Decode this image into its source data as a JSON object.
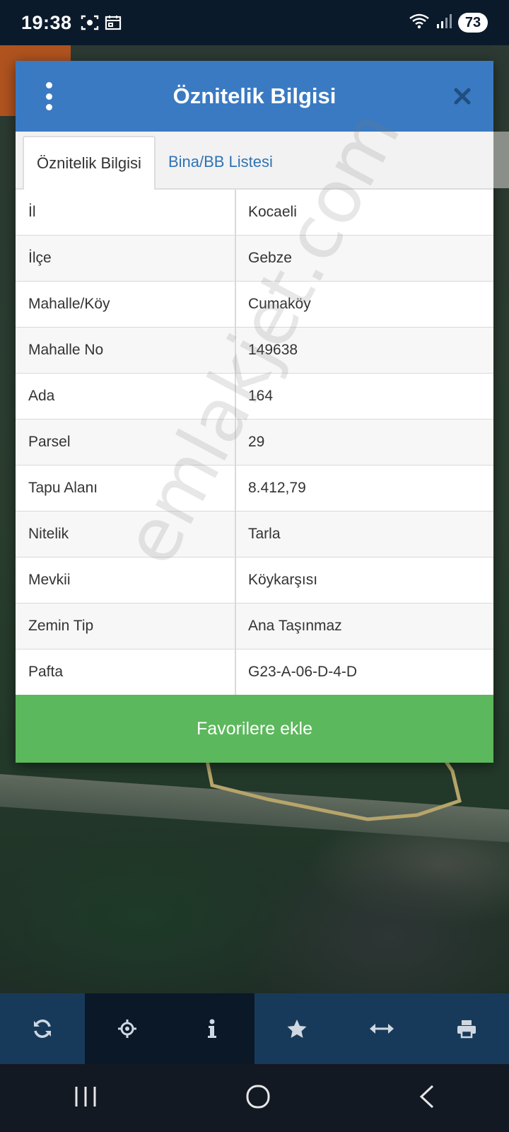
{
  "status_bar": {
    "time": "19:38",
    "battery": "73",
    "icons": [
      "screenshot-icon",
      "calendar-icon",
      "wifi-icon",
      "signal-icon"
    ]
  },
  "modal": {
    "title": "Öznitelik Bilgisi",
    "tabs": [
      {
        "label": "Öznitelik Bilgisi",
        "active": true
      },
      {
        "label": "Bina/BB Listesi",
        "active": false
      }
    ],
    "rows": [
      {
        "label": "İl",
        "value": "Kocaeli"
      },
      {
        "label": "İlçe",
        "value": "Gebze"
      },
      {
        "label": "Mahalle/Köy",
        "value": "Cumaköy"
      },
      {
        "label": "Mahalle No",
        "value": "149638"
      },
      {
        "label": "Ada",
        "value": "164"
      },
      {
        "label": "Parsel",
        "value": "29"
      },
      {
        "label": "Tapu Alanı",
        "value": "8.412,79"
      },
      {
        "label": "Nitelik",
        "value": "Tarla"
      },
      {
        "label": "Mevkii",
        "value": "Köykarşısı"
      },
      {
        "label": "Zemin Tip",
        "value": "Ana Taşınmaz"
      },
      {
        "label": "Pafta",
        "value": "G23-A-06-D-4-D"
      }
    ],
    "favorite_button": "Favorilere ekle"
  },
  "watermark": "emlakjet.com",
  "toolbar": {
    "items": [
      "refresh-icon",
      "locate-icon",
      "info-icon",
      "star-icon",
      "measure-icon",
      "print-icon"
    ],
    "active": [
      "locate-icon",
      "info-icon"
    ]
  },
  "colors": {
    "header": "#3a7ac2",
    "favorite": "#5cb85c",
    "tab_link": "#2f74b4",
    "toolbar": "#183a5a"
  }
}
